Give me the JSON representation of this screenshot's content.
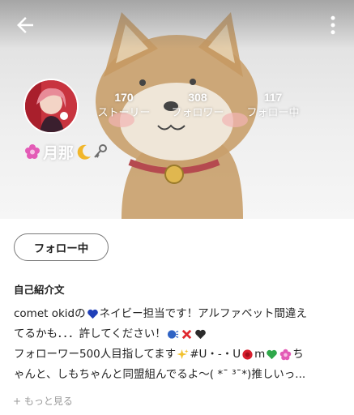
{
  "toolbar": {
    "back_icon": "arrow-left-icon",
    "menu_icon": "more-vertical-icon"
  },
  "profile": {
    "avatar_icon": "avatar-image",
    "name": "月那",
    "name_decorations": [
      "flower-icon",
      "crescent-moon-icon",
      "key-icon"
    ],
    "stats": [
      {
        "count": "170",
        "label": "ストーリー"
      },
      {
        "count": "308",
        "label": "フォロワー"
      },
      {
        "count": "117",
        "label": "フォロー中"
      }
    ]
  },
  "follow_button": {
    "label": "フォロー中"
  },
  "intro": {
    "heading": "自己紹介文",
    "lines": [
      {
        "a": "comet okidの",
        "b": "ネイビー担当です！アルファベット間違え"
      },
      {
        "a": "てるかも．．．許してください！"
      },
      {
        "a": "フォローワー500人目指してます",
        "b": "#U・-・U",
        "c": "m",
        "d": "ち"
      },
      {
        "a": "ゃんと、しもちゃんと同盟組んでるよ〜( *¯ ³¯*)推しいっ..."
      }
    ],
    "more_label": "もっと見る",
    "more_prefix": "+"
  },
  "colors": {
    "accent_heart": "#1f3fb8",
    "red_x": "#e0282e",
    "green_heart": "#2fa84a",
    "pink_flower": "#e35bb6"
  }
}
